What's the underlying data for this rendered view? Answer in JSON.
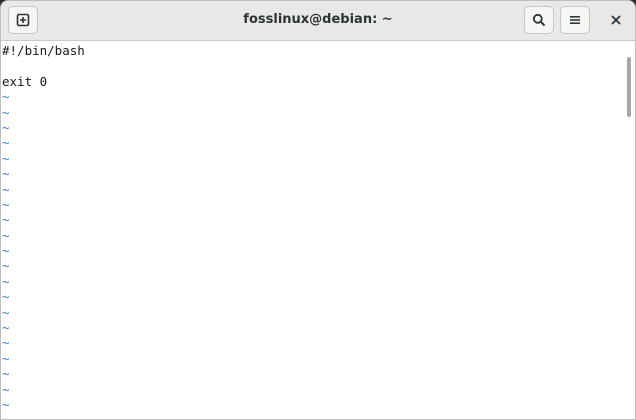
{
  "window": {
    "title": "fosslinux@debian: ~"
  },
  "header": {
    "new_tab_icon": "new-tab-icon",
    "search_icon": "search-icon",
    "menu_icon": "hamburger-menu-icon",
    "close_icon": "close-icon"
  },
  "editor": {
    "lines": [
      "#!/bin/bash",
      "",
      "exit 0"
    ],
    "tilde": "~",
    "tilde_color": "#3b7fd0"
  }
}
